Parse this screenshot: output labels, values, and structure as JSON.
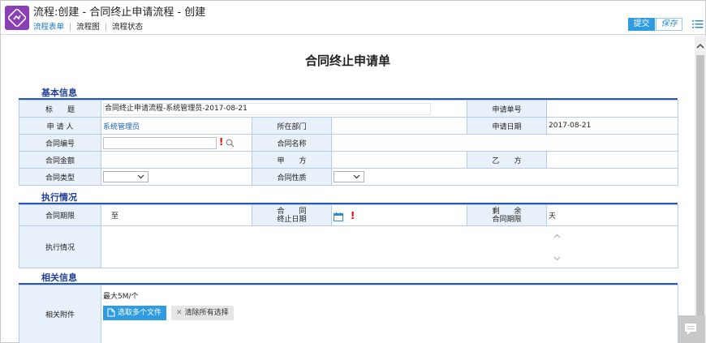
{
  "header": {
    "title": "流程:创建 - 合同终止申请流程 - 创建",
    "tabs": [
      {
        "label": "流程表单",
        "active": true
      },
      {
        "label": "流程图",
        "active": false
      },
      {
        "label": "流程状态",
        "active": false
      }
    ],
    "submit_label": "提交",
    "save_label": "保存",
    "app_icon": "workflow-icon",
    "accent_color": "#8a3fb4",
    "primary_color": "#2f9be0"
  },
  "form": {
    "title": "合同终止申请单",
    "sections": {
      "basic": "基本信息",
      "execution": "执行情况",
      "related": "相关信息"
    },
    "basic": {
      "title_label": "标　　题",
      "title_value": "合同终止申请流程-系统管理员-2017-08-21",
      "request_no_label": "申请单号",
      "request_no_value": "",
      "applicant_label": "申 请 人",
      "applicant_value": "系统管理员",
      "dept_label": "所在部门",
      "dept_value": "",
      "date_label": "申请日期",
      "date_value": "2017-08-21",
      "contract_no_label": "合同编号",
      "contract_no_value": "",
      "contract_name_label": "合同名称",
      "contract_name_value": "",
      "amount_label": "合同金额",
      "amount_value": "",
      "party_a_label": "甲　　方",
      "party_a_value": "",
      "party_b_label": "乙　　方",
      "party_b_value": "",
      "type_label": "合同类型",
      "type_value": "",
      "nature_label": "合同性质",
      "nature_value": ""
    },
    "execution": {
      "period_label": "合同期限",
      "period_to": "至",
      "end_date_label_1": "合　　同",
      "end_date_label_2": "终止日期",
      "remain_label_1": "剩　　余",
      "remain_label_2": "合同期限",
      "remain_unit": "天",
      "status_label": "执行情况",
      "status_value": ""
    },
    "related": {
      "attach_label": "相关附件",
      "limit_text": "最大5M/个",
      "select_files_label": "选取多个文件",
      "clear_label": "清除所有选择"
    }
  }
}
